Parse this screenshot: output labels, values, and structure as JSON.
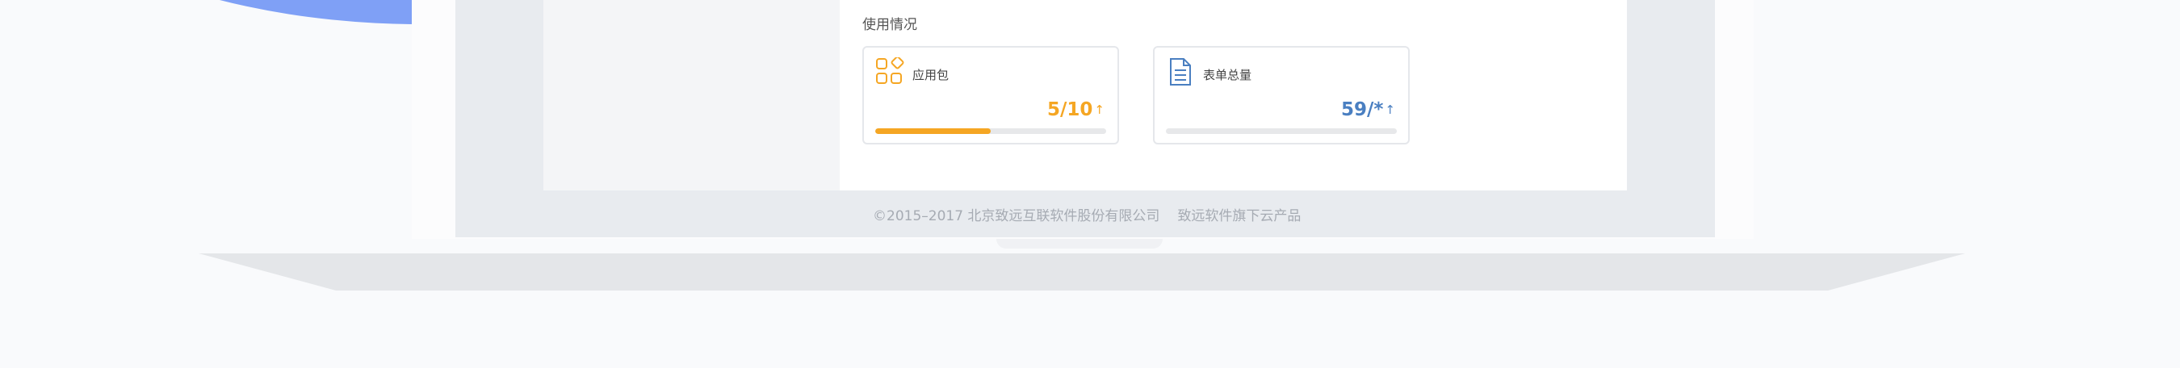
{
  "usage": {
    "title": "使用情况",
    "cards": [
      {
        "label": "应用包",
        "value": "5/10",
        "arrow": "↑",
        "progress": 0.5,
        "color": "#f5a623",
        "icon": "app-grid-icon"
      },
      {
        "label": "表单总量",
        "value": "59/*",
        "arrow": "↑",
        "progress": 0,
        "color": "#4a7fc1",
        "icon": "document-icon"
      }
    ]
  },
  "footer": {
    "copyright": "©2015–2017 北京致远互联软件股份有限公司",
    "product": "致远软件旗下云产品"
  }
}
